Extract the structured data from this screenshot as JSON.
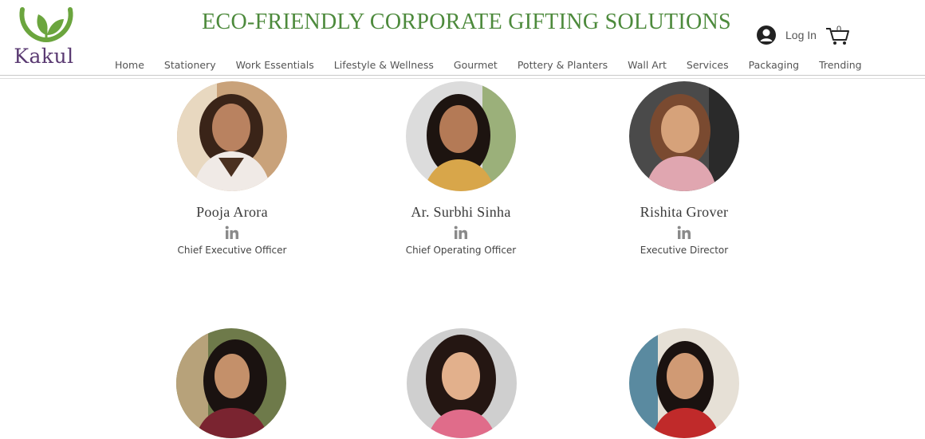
{
  "header": {
    "logo_text": "Kakul",
    "site_title": "ECO-FRIENDLY CORPORATE GIFTING SOLUTIONS",
    "login_label": "Log In",
    "cart_count": "0"
  },
  "nav": {
    "items": [
      {
        "label": "Home"
      },
      {
        "label": "Stationery"
      },
      {
        "label": "Work Essentials"
      },
      {
        "label": "Lifestyle & Wellness"
      },
      {
        "label": "Gourmet"
      },
      {
        "label": "Pottery & Planters"
      },
      {
        "label": "Wall Art"
      },
      {
        "label": "Services"
      },
      {
        "label": "Packaging"
      },
      {
        "label": "Trending"
      }
    ]
  },
  "team": {
    "members": [
      {
        "name": "Pooja Arora",
        "role": "Chief Executive Officer",
        "social_icon": "linkedin-icon"
      },
      {
        "name": "Ar. Surbhi Sinha",
        "role": "Chief Operating Officer",
        "social_icon": "linkedin-icon"
      },
      {
        "name": "Rishita Grover",
        "role": "Executive Director",
        "social_icon": "linkedin-icon"
      }
    ]
  },
  "colors": {
    "brand_green": "#4d8a3c",
    "logo_purple": "#5a3a72",
    "nav_text": "#555555",
    "icon_gray": "#8a8a8a"
  }
}
